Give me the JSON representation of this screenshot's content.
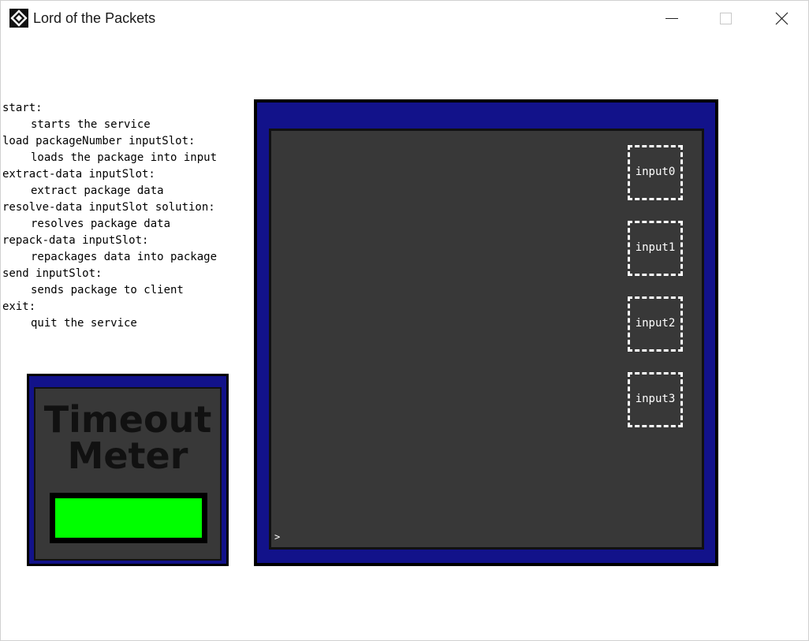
{
  "window": {
    "title": "Lord of the Packets",
    "icon": "app-logo-icon",
    "controls": [
      "minimize-icon",
      "maximize-icon",
      "close-icon"
    ]
  },
  "help": {
    "commands": [
      {
        "cmd": "start:",
        "desc": "starts the service"
      },
      {
        "cmd": "load packageNumber inputSlot:",
        "desc": "loads the package into input"
      },
      {
        "cmd": "extract-data inputSlot:",
        "desc": "extract package data"
      },
      {
        "cmd": "resolve-data inputSlot solution:",
        "desc": "resolves package data"
      },
      {
        "cmd": "repack-data inputSlot:",
        "desc": "repackages data into package"
      },
      {
        "cmd": "send inputSlot:",
        "desc": "sends package to client"
      },
      {
        "cmd": "exit:",
        "desc": "quit the service"
      }
    ]
  },
  "meter": {
    "title_line1": "Timeout",
    "title_line2": "Meter",
    "level": 1.0,
    "fill_color": "#00ff00"
  },
  "terminal": {
    "slots": [
      "input0",
      "input1",
      "input2",
      "input3"
    ],
    "prompt": ">"
  },
  "colors": {
    "panel_blue": "#12128a",
    "screen_gray": "#383838"
  }
}
